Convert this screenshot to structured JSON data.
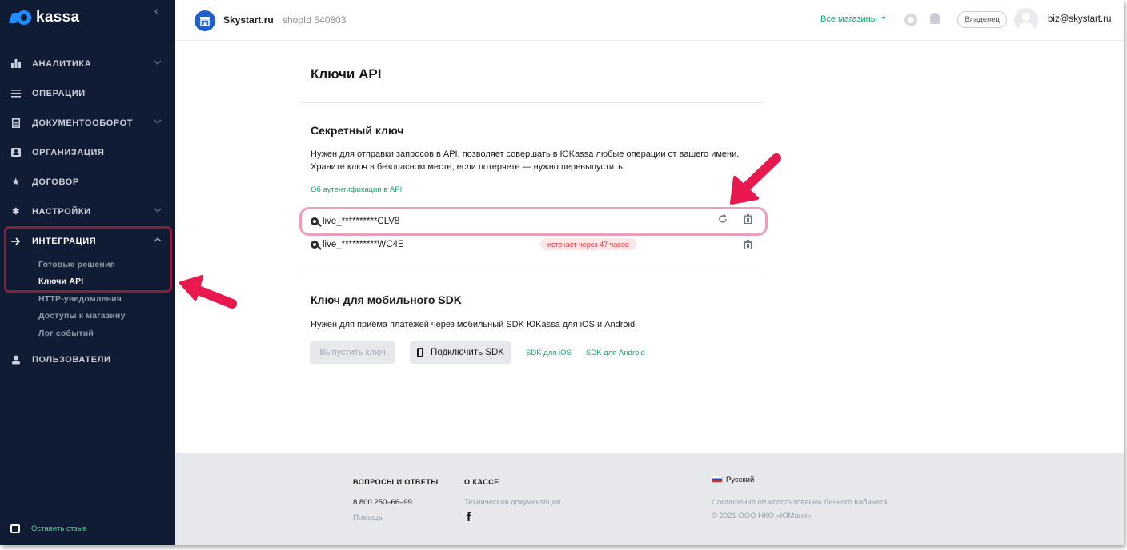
{
  "brand": {
    "logo_text": "kassa"
  },
  "sidebar": {
    "items": [
      {
        "label": "АНАЛИТИКА",
        "icon": "bar-chart-icon",
        "chevron": "⌵"
      },
      {
        "label": "ОПЕРАЦИИ",
        "icon": "list-icon",
        "chevron": ""
      },
      {
        "label": "ДОКУМЕНТООБОРОТ",
        "icon": "document-icon",
        "chevron": "⌵"
      },
      {
        "label": "ОРГАНИЗАЦИЯ",
        "icon": "id-card-icon",
        "chevron": ""
      },
      {
        "label": "ДОГОВОР",
        "icon": "star-icon",
        "chevron": ""
      },
      {
        "label": "НАСТРОЙКИ",
        "icon": "gear-icon",
        "chevron": "⌵"
      },
      {
        "label": "ИНТЕГРАЦИЯ",
        "icon": "arrow-right-icon",
        "chevron": "^"
      }
    ],
    "subitems": [
      "Готовые решения",
      "Ключи API",
      "HTTP-уведомления",
      "Доступы к магазину",
      "Лог событий"
    ],
    "users_label": "ПОЛЬЗОВАТЕЛИ",
    "feedback_label": "Оставить отзыв"
  },
  "header": {
    "shop_name": "Skystart.ru",
    "shop_id": "shopId 540803",
    "all_shops": "Все магазины",
    "role": "Владелец",
    "email": "biz@skystart.ru"
  },
  "main": {
    "title": "Ключи API",
    "secret": {
      "title": "Секретный ключ",
      "desc_line1": "Нужен для отправки запросов в API, позволяет совершать в ЮKassa любые операции от вашего имени.",
      "desc_line2": "Храните ключ в безопасном месте, если потеряете — нужно перевыпустить.",
      "auth_link": "Об аутентификации в API",
      "keys": [
        {
          "value": "live_**********CLV8",
          "badge": ""
        },
        {
          "value": "live_**********WC4E",
          "badge": "истекает через 47 часов"
        }
      ]
    },
    "sdk": {
      "title": "Ключ для мобильного SDK",
      "desc": "Нужен для приёма платежей через мобильный SDK ЮKassa для iOS и Android.",
      "issue_button": "Выпустить ключ",
      "connect_button": "Подключить SDK",
      "ios_link": "SDK для iOS",
      "android_link": "SDK для Android"
    }
  },
  "footer": {
    "faq_title": "ВОПРОСЫ И ОТВЕТЫ",
    "phone": "8 800 250–66–99",
    "help": "Помощь",
    "about_title": "О КАССЕ",
    "tech_docs": "Техническая документация",
    "language": "Русский",
    "agreement": "Соглашение об использовании Личного Кабинета",
    "copyright": "© 2021 ООО НКО «ЮМани»"
  },
  "colors": {
    "accent_green": "#1aa36f",
    "sidebar_bg": "#0f1c33",
    "annotation_arrow": "#e8194f"
  }
}
